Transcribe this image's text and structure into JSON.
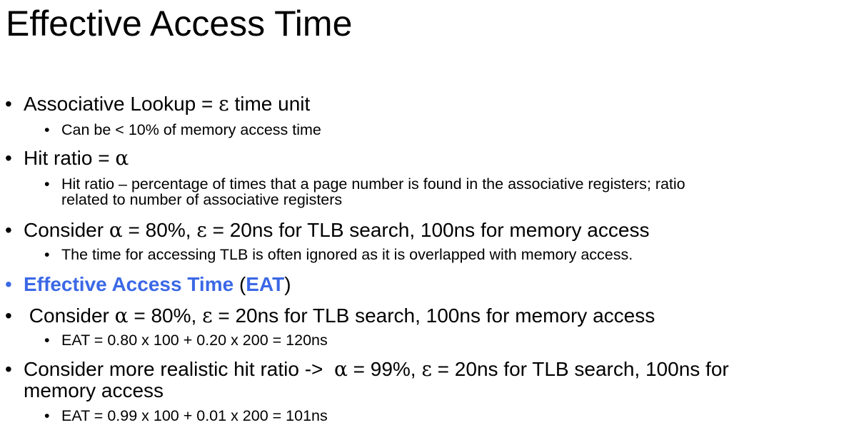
{
  "slide": {
    "title": "Effective Access Time",
    "bullets": [
      {
        "pre": "Associative Lookup = ",
        "sym": "ε",
        "post": " time unit"
      },
      {
        "text": "Can be < 10% of memory access time"
      },
      {
        "pre": "Hit ratio = ",
        "sym": "α"
      },
      {
        "line1": "Hit ratio – percentage of times that a page number is found in the associative registers; ratio",
        "line2": "related to number of associative registers"
      },
      {
        "pre": "Consider ",
        "sym1": "α",
        "mid": " = 80%, ",
        "sym2": "ε",
        "post": " = 20ns for TLB search, 100ns for memory access"
      },
      {
        "text": "The time for accessing TLB is often ignored as it is overlapped with memory access."
      },
      {
        "term": "Effective Access Time",
        "open": " (",
        "abbr": "EAT",
        "close": ")"
      },
      {
        "pre": " Consider ",
        "sym1": "α",
        "mid": " = 80%, ",
        "sym2": "ε",
        "post": " = 20ns for TLB search, 100ns for memory access"
      },
      {
        "text": "EAT = 0.80 x 100 + 0.20 x 200 = 120ns"
      },
      {
        "pre": "Consider more realistic hit ratio ->  ",
        "sym1": "α",
        "mid": " = 99%, ",
        "sym2": "ε",
        "post": " = 20ns for TLB search, 100ns for",
        "line2": "memory access"
      },
      {
        "text": "EAT = 0.99 x 100 + 0.01 x 200 = 101ns"
      }
    ]
  },
  "colors": {
    "accent": "#3b68e6",
    "text": "#000000",
    "background": "#ffffff"
  }
}
